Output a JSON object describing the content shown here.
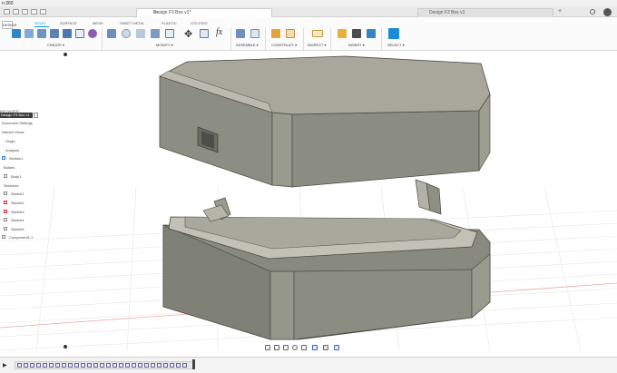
{
  "window": {
    "app_title": "n 360"
  },
  "tabs": {
    "active_document": "Design F3 Box v1*",
    "second_document": "Design F3 Box v1"
  },
  "ribbon": {
    "design_button": "DESIGN",
    "tabs": [
      {
        "label": "SOLID",
        "active": true
      },
      {
        "label": "SURFACE",
        "active": false
      },
      {
        "label": "MESH",
        "active": false
      },
      {
        "label": "SHEET METAL",
        "active": false
      },
      {
        "label": "PLASTIC",
        "active": false
      },
      {
        "label": "UTILITIES",
        "active": false
      }
    ],
    "groups": [
      {
        "label": "CREATE ▾"
      },
      {
        "label": "MODIFY ▾"
      },
      {
        "label": "ASSEMBLE ▾"
      },
      {
        "label": "CONSTRUCT ▾"
      },
      {
        "label": "INSPECT ▾"
      },
      {
        "label": "INSERT ▾"
      },
      {
        "label": "SELECT ▾"
      }
    ],
    "formula_glyph": "fx"
  },
  "browser": {
    "panel_label": "BROWSER",
    "root": "Design F3 Box v1",
    "items": [
      {
        "label": "Document Settings"
      },
      {
        "label": "Named Views"
      },
      {
        "label": "Origin"
      },
      {
        "label": "Analysis"
      },
      {
        "label": "Section1"
      },
      {
        "label": "Bodies"
      },
      {
        "label": "Body1"
      },
      {
        "label": "Sketches"
      },
      {
        "label": "Sketch1"
      },
      {
        "label": "Sketch2"
      },
      {
        "label": "Sketch3"
      },
      {
        "label": "Sketch4"
      },
      {
        "label": "Sketch5"
      },
      {
        "label": "Component1:1"
      }
    ]
  },
  "colors": {
    "accent": "#0696d7",
    "body_face": "#8a8a7e",
    "body_top": "#a7a699",
    "background": "#ffffff"
  },
  "icons": {
    "nav": [
      "orbit-icon",
      "pan-icon",
      "look-at-icon",
      "zoom-icon",
      "zoom-window-icon",
      "display-settings-icon",
      "grid-icon",
      "viewports-icon"
    ],
    "timeline": [
      "skip-start-icon",
      "step-back-icon",
      "play-icon",
      "step-forward-icon",
      "skip-end-icon"
    ]
  },
  "timeline": {
    "play_glyph": "▶"
  }
}
